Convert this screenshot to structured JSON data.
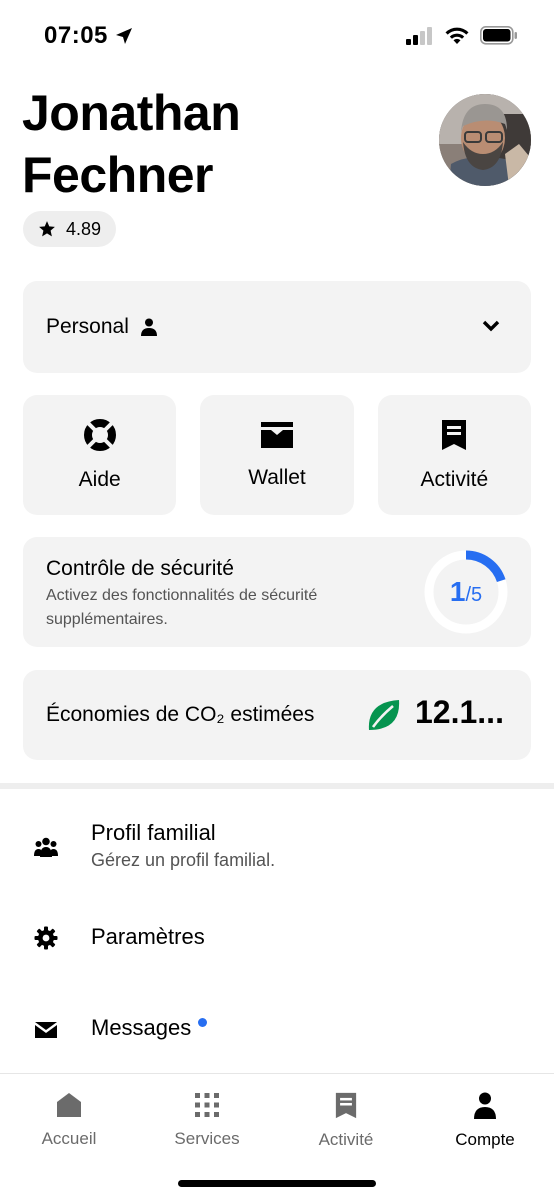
{
  "status_bar": {
    "time": "07:05"
  },
  "profile": {
    "first_name": "Jonathan",
    "last_name": "Fechner",
    "rating": "4.89"
  },
  "profile_switcher": {
    "label": "Personal"
  },
  "tiles": [
    {
      "label": "Aide",
      "icon": "lifebuoy-icon"
    },
    {
      "label": "Wallet",
      "icon": "wallet-icon"
    },
    {
      "label": "Activité",
      "icon": "receipt-icon"
    }
  ],
  "safety_check": {
    "title": "Contrôle de sécurité",
    "subtitle": "Activez des fonctionnalités de sécurité supplémentaires.",
    "progress_done": "1",
    "progress_total": "/5",
    "progress_fraction": 0.2,
    "accent": "#276ef1"
  },
  "co2": {
    "title": "Économies de CO₂ estimées",
    "value": "12.1...",
    "leaf_color": "#05944f"
  },
  "list": [
    {
      "title": "Profil familial",
      "subtitle": "Gérez un profil familial.",
      "icon": "family-icon"
    },
    {
      "title": "Paramètres",
      "icon": "gear-icon"
    },
    {
      "title": "Messages",
      "icon": "mail-icon",
      "has_unread_dot": true
    }
  ],
  "bottom_nav": [
    {
      "label": "Accueil",
      "icon": "home-icon"
    },
    {
      "label": "Services",
      "icon": "grid-icon"
    },
    {
      "label": "Activité",
      "icon": "receipt-icon"
    },
    {
      "label": "Compte",
      "icon": "person-icon",
      "active": true
    }
  ]
}
